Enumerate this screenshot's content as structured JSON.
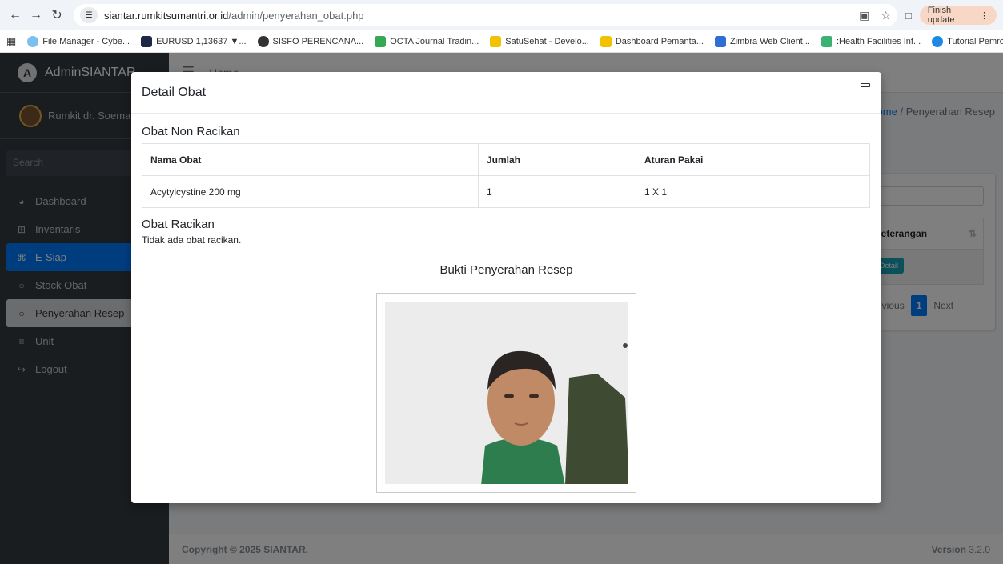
{
  "browser": {
    "url_host": "siantar.rumkitsumantri.or.id",
    "url_path": "/admin/penyerahan_obat.php",
    "finish_update": "Finish update",
    "bookmarks": [
      "File Manager - Cybe...",
      "EURUSD 1,13637 ▼...",
      "SISFO PERENCANA...",
      "OCTA Journal Tradin...",
      "SatuSehat - Develo...",
      "Dashboard Pemanta...",
      "Zimbra Web Client...",
      ":Health Facilities Inf...",
      "Tutorial Pemrogram..."
    ],
    "more": "»"
  },
  "sidebar": {
    "brand": "AdminSIANTAR",
    "user": "Rumkit dr. Soeman",
    "search": "Search",
    "items": [
      {
        "label": "Dashboard",
        "icon": "◕"
      },
      {
        "label": "Inventaris",
        "icon": "⊞"
      },
      {
        "label": "E-Siap",
        "icon": "⌘"
      },
      {
        "label": "Stock Obat",
        "icon": "○"
      },
      {
        "label": "Penyerahan Resep",
        "icon": "○"
      },
      {
        "label": "Unit",
        "icon": "≡"
      },
      {
        "label": "Logout",
        "icon": "↪"
      }
    ]
  },
  "topnav": {
    "home": "Home"
  },
  "breadcrumb": {
    "home": "Home",
    "sep": " / ",
    "current": "Penyerahan Resep"
  },
  "table_peek": {
    "header": "Keterangan",
    "detail_btn": "Detail",
    "previous": "Previous",
    "page": "1",
    "next": "Next"
  },
  "footer": {
    "copyright": "Copyright © 2025 SIANTAR.",
    "version_label": "Version",
    "version": "3.2.0"
  },
  "modal": {
    "title": "Detail Obat",
    "non_racikan_title": "Obat Non Racikan",
    "columns": [
      "Nama Obat",
      "Jumlah",
      "Aturan Pakai"
    ],
    "rows": [
      [
        "Acytylcystine 200 mg",
        "1",
        "1 X 1"
      ]
    ],
    "racikan_title": "Obat Racikan",
    "racikan_empty": "Tidak ada obat racikan.",
    "bukti_title": "Bukti Penyerahan Resep"
  }
}
